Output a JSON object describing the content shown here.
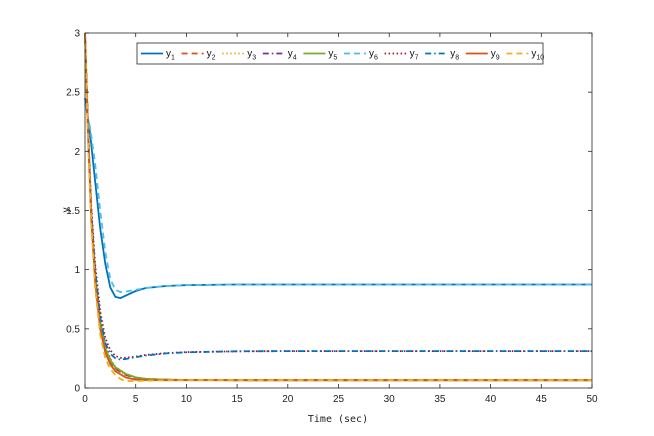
{
  "chart_data": {
    "type": "line",
    "title": "",
    "xlabel": "Time (sec)",
    "ylabel": "y",
    "xlim": [
      0,
      50
    ],
    "ylim": [
      0,
      3
    ],
    "xticks": [
      0,
      5,
      10,
      15,
      20,
      25,
      30,
      35,
      40,
      45,
      50
    ],
    "yticks": [
      0,
      0.5,
      1,
      1.5,
      2,
      2.5,
      3
    ],
    "xtick_labels": [
      "0",
      "5",
      "10",
      "15",
      "20",
      "25",
      "30",
      "35",
      "40",
      "45",
      "50"
    ],
    "ytick_labels": [
      "0",
      "0.5",
      "1",
      "1.5",
      "2",
      "2.5",
      "3"
    ],
    "grid": false,
    "legend_position": "top",
    "legend_orientation": "horizontal",
    "series": [
      {
        "name": "y1",
        "label_main": "y",
        "label_sub": "1",
        "color": "#0072BD",
        "style": "solid",
        "x": [
          0,
          0.5,
          1,
          1.5,
          2,
          2.5,
          3,
          3.5,
          4,
          5,
          6,
          8,
          10,
          15,
          20,
          50
        ],
        "y": [
          2.45,
          2.15,
          1.75,
          1.35,
          1.05,
          0.85,
          0.77,
          0.76,
          0.78,
          0.82,
          0.845,
          0.862,
          0.87,
          0.875,
          0.875,
          0.875
        ]
      },
      {
        "name": "y2",
        "label_main": "y",
        "label_sub": "2",
        "color": "#D95319",
        "style": "dashed",
        "x": [
          0,
          0.3,
          0.6,
          1,
          1.5,
          2,
          2.5,
          3,
          4,
          5,
          6,
          8,
          10,
          15,
          50
        ],
        "y": [
          3.0,
          2.2,
          1.5,
          0.95,
          0.55,
          0.32,
          0.22,
          0.16,
          0.11,
          0.085,
          0.075,
          0.07,
          0.068,
          0.066,
          0.066
        ]
      },
      {
        "name": "y3",
        "label_main": "y",
        "label_sub": "3",
        "color": "#EDB120",
        "style": "dotted",
        "x": [
          0,
          0.3,
          0.6,
          1,
          1.5,
          2,
          2.5,
          3,
          4,
          5,
          6,
          8,
          10,
          15,
          50
        ],
        "y": [
          3.0,
          2.25,
          1.55,
          1.0,
          0.6,
          0.36,
          0.25,
          0.18,
          0.12,
          0.09,
          0.078,
          0.07,
          0.068,
          0.066,
          0.066
        ]
      },
      {
        "name": "y4",
        "label_main": "y",
        "label_sub": "4",
        "color": "#7E2F8E",
        "style": "dashdot",
        "x": [
          0,
          0.3,
          0.6,
          1,
          1.5,
          2,
          2.5,
          3,
          4,
          5,
          6,
          8,
          10,
          15,
          50
        ],
        "y": [
          3.0,
          2.2,
          1.52,
          0.97,
          0.58,
          0.35,
          0.24,
          0.17,
          0.115,
          0.088,
          0.076,
          0.07,
          0.068,
          0.066,
          0.066
        ]
      },
      {
        "name": "y5",
        "label_main": "y",
        "label_sub": "5",
        "color": "#77AC30",
        "style": "solid",
        "x": [
          0,
          0.3,
          0.6,
          1,
          1.5,
          2,
          2.5,
          3,
          4,
          5,
          6,
          8,
          10,
          15,
          50
        ],
        "y": [
          3.0,
          2.18,
          1.5,
          0.96,
          0.57,
          0.34,
          0.235,
          0.175,
          0.12,
          0.09,
          0.078,
          0.07,
          0.068,
          0.066,
          0.066
        ]
      },
      {
        "name": "y6",
        "label_main": "y",
        "label_sub": "6",
        "color": "#4DBEEE",
        "style": "dashed",
        "x": [
          0,
          0.5,
          1,
          1.5,
          2,
          2.5,
          3,
          3.5,
          4,
          5,
          6,
          8,
          10,
          15,
          20,
          50
        ],
        "y": [
          2.4,
          2.2,
          1.9,
          1.5,
          1.15,
          0.92,
          0.83,
          0.81,
          0.815,
          0.83,
          0.845,
          0.862,
          0.87,
          0.875,
          0.875,
          0.875
        ]
      },
      {
        "name": "y7",
        "label_main": "y",
        "label_sub": "7",
        "color": "#A2142F",
        "style": "dotted",
        "x": [
          0,
          0.3,
          0.6,
          1,
          1.5,
          2,
          2.5,
          3,
          3.5,
          4,
          5,
          6,
          8,
          10,
          15,
          20,
          50
        ],
        "y": [
          3.0,
          2.2,
          1.55,
          1.05,
          0.65,
          0.42,
          0.32,
          0.27,
          0.255,
          0.255,
          0.265,
          0.28,
          0.295,
          0.303,
          0.31,
          0.312,
          0.312
        ]
      },
      {
        "name": "y8",
        "label_main": "y",
        "label_sub": "8",
        "color": "#0072BD",
        "style": "dashdot",
        "x": [
          0,
          0.3,
          0.6,
          1,
          1.5,
          2,
          2.5,
          3,
          3.5,
          4,
          5,
          6,
          8,
          10,
          15,
          20,
          50
        ],
        "y": [
          3.0,
          2.18,
          1.5,
          1.0,
          0.6,
          0.38,
          0.29,
          0.25,
          0.24,
          0.245,
          0.26,
          0.275,
          0.292,
          0.302,
          0.31,
          0.312,
          0.312
        ]
      },
      {
        "name": "y9",
        "label_main": "y",
        "label_sub": "9",
        "color": "#D95319",
        "style": "solid",
        "x": [
          0,
          0.3,
          0.6,
          1,
          1.5,
          2,
          2.5,
          3,
          4,
          5,
          6,
          8,
          10,
          15,
          50
        ],
        "y": [
          3.0,
          2.15,
          1.45,
          0.9,
          0.5,
          0.3,
          0.2,
          0.14,
          0.09,
          0.07,
          0.068,
          0.066,
          0.066,
          0.066,
          0.066
        ]
      },
      {
        "name": "y10",
        "label_main": "y",
        "label_sub": "10",
        "color": "#EDB120",
        "style": "dashed",
        "x": [
          0,
          0.3,
          0.6,
          1,
          1.5,
          2,
          2.5,
          3,
          3.5,
          4,
          5,
          6,
          8,
          10,
          15,
          50
        ],
        "y": [
          3.0,
          2.1,
          1.4,
          0.85,
          0.45,
          0.25,
          0.16,
          0.11,
          0.075,
          0.06,
          0.058,
          0.062,
          0.065,
          0.066,
          0.066,
          0.066
        ]
      }
    ]
  }
}
